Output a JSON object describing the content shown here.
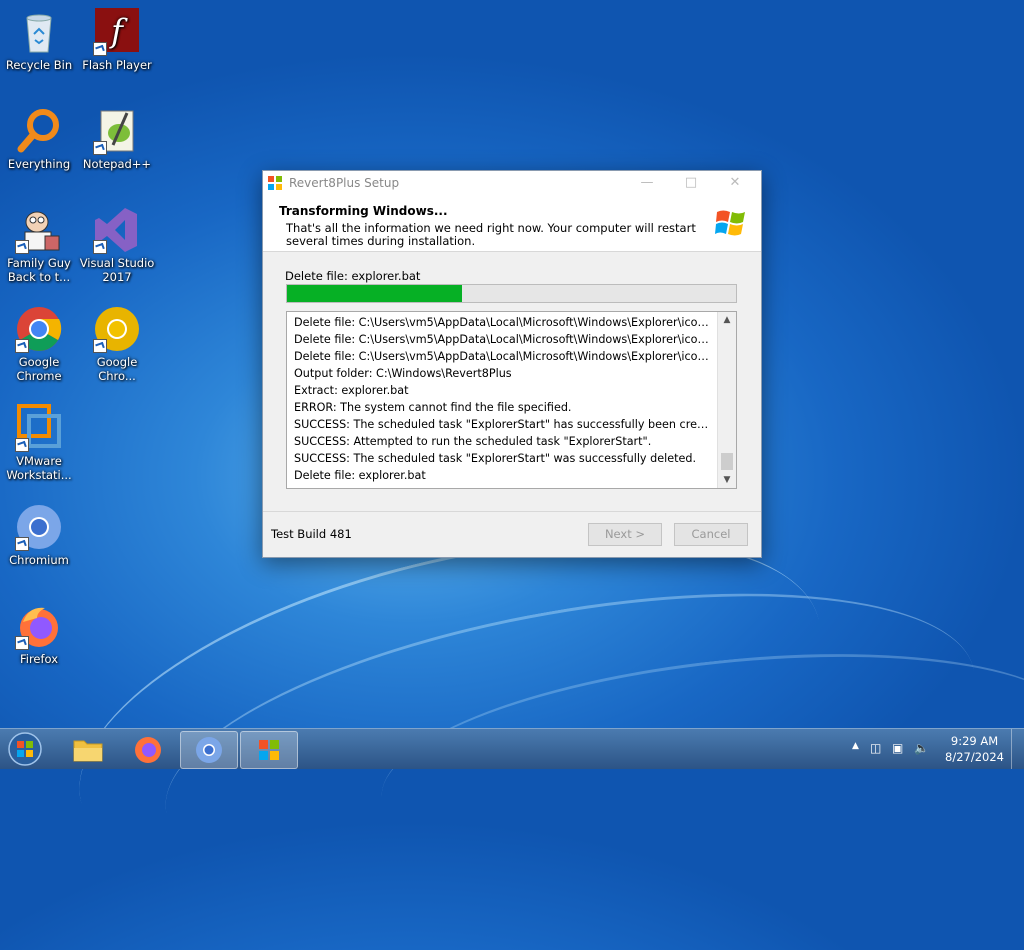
{
  "desktop": {
    "icons": [
      {
        "label": "Recycle Bin"
      },
      {
        "label": "Flash Player"
      },
      {
        "label": "Everything"
      },
      {
        "label": "Notepad++"
      },
      {
        "label": "Family Guy Back to t..."
      },
      {
        "label": "Visual Studio 2017"
      },
      {
        "label": "Google Chrome"
      },
      {
        "label": "Google Chro..."
      },
      {
        "label": "VMware Workstati..."
      },
      {
        "label": "Chromium"
      },
      {
        "label": "Firefox"
      }
    ]
  },
  "dialog": {
    "title": "Revert8Plus Setup",
    "heading": "Transforming Windows...",
    "subheading": "That's all the information we need right now. Your computer will restart several times during installation.",
    "status": "Delete file: explorer.bat",
    "progress": 0.39,
    "log": [
      "Delete file: C:\\Users\\vm5\\AppData\\Local\\Microsoft\\Windows\\Explorer\\iconcache_sr.db",
      "Delete file: C:\\Users\\vm5\\AppData\\Local\\Microsoft\\Windows\\Explorer\\iconcache_wid...",
      "Delete file: C:\\Users\\vm5\\AppData\\Local\\Microsoft\\Windows\\Explorer\\iconcache_wid...",
      "Output folder: C:\\Windows\\Revert8Plus",
      "Extract: explorer.bat",
      "ERROR: The system cannot find the file specified.",
      "SUCCESS: The scheduled task \"ExplorerStart\" has successfully been created.",
      "SUCCESS: Attempted to run the scheduled task \"ExplorerStart\".",
      "SUCCESS: The scheduled task \"ExplorerStart\" was successfully deleted.",
      "Delete file: explorer.bat"
    ],
    "footer": "Test Build 481",
    "next_label": "Next >",
    "cancel_label": "Cancel"
  },
  "taskbar": {
    "items": [
      "start",
      "file-explorer",
      "firefox",
      "chromium",
      "revert8plus-setup"
    ],
    "clock": {
      "time": "9:29 AM",
      "date": "8/27/2024"
    }
  },
  "colors": {
    "progress": "#06b025",
    "taskbar": "#3a6aa0"
  }
}
